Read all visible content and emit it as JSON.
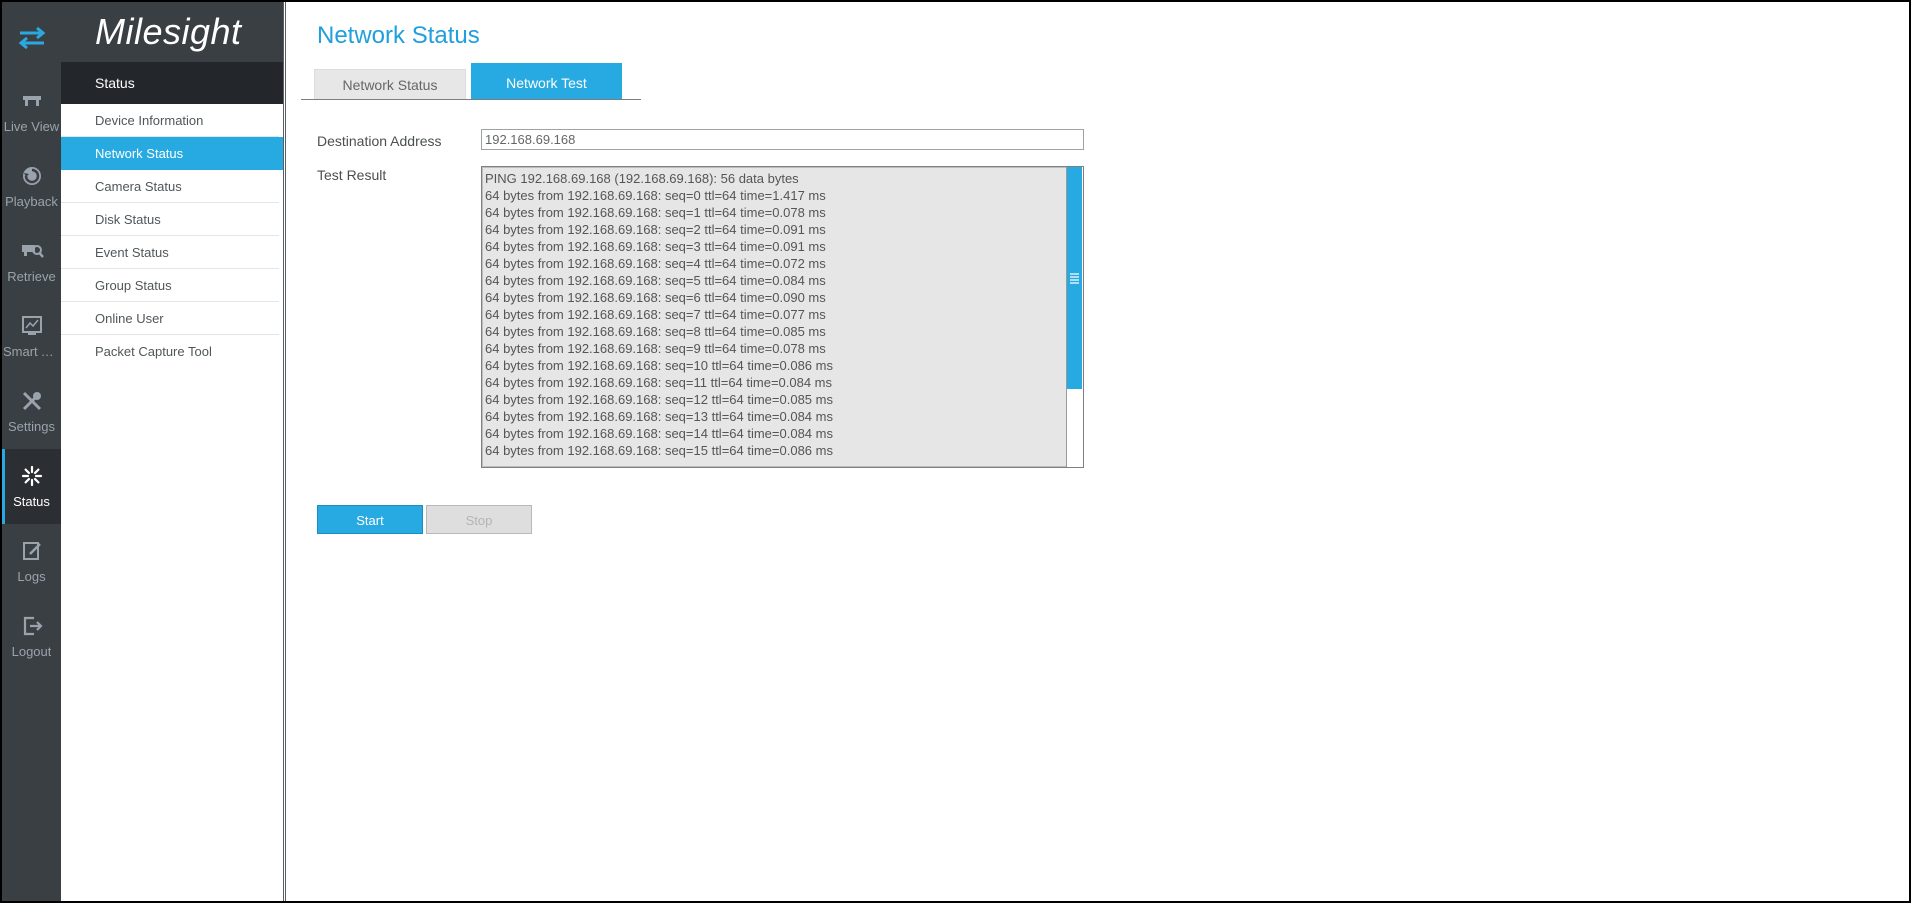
{
  "app": {
    "logo": "Milesight"
  },
  "rail": {
    "items": [
      {
        "label": "Live View",
        "icon": "live-view-icon"
      },
      {
        "label": "Playback",
        "icon": "playback-icon"
      },
      {
        "label": "Retrieve",
        "icon": "retrieve-icon"
      },
      {
        "label": "Smart A...",
        "icon": "smart-analysis-icon"
      },
      {
        "label": "Settings",
        "icon": "settings-icon"
      },
      {
        "label": "Status",
        "icon": "status-icon",
        "active": true
      },
      {
        "label": "Logs",
        "icon": "logs-icon"
      },
      {
        "label": "Logout",
        "icon": "logout-icon"
      }
    ]
  },
  "sidebar": {
    "section_title": "Status",
    "items": [
      {
        "label": "Device Information"
      },
      {
        "label": "Network Status",
        "active": true
      },
      {
        "label": "Camera Status"
      },
      {
        "label": "Disk Status"
      },
      {
        "label": "Event Status"
      },
      {
        "label": "Group Status"
      },
      {
        "label": "Online User"
      },
      {
        "label": "Packet Capture Tool"
      }
    ]
  },
  "main": {
    "title": "Network Status",
    "tabs": [
      {
        "label": "Network Status",
        "active": false
      },
      {
        "label": "Network Test",
        "active": true
      }
    ],
    "destination_label": "Destination Address",
    "destination_value": "192.168.69.168",
    "result_label": "Test Result",
    "result_lines": [
      "PING 192.168.69.168 (192.168.69.168): 56 data bytes",
      "64 bytes from 192.168.69.168: seq=0 ttl=64 time=1.417 ms",
      "64 bytes from 192.168.69.168: seq=1 ttl=64 time=0.078 ms",
      "64 bytes from 192.168.69.168: seq=2 ttl=64 time=0.091 ms",
      "64 bytes from 192.168.69.168: seq=3 ttl=64 time=0.091 ms",
      "64 bytes from 192.168.69.168: seq=4 ttl=64 time=0.072 ms",
      "64 bytes from 192.168.69.168: seq=5 ttl=64 time=0.084 ms",
      "64 bytes from 192.168.69.168: seq=6 ttl=64 time=0.090 ms",
      "64 bytes from 192.168.69.168: seq=7 ttl=64 time=0.077 ms",
      "64 bytes from 192.168.69.168: seq=8 ttl=64 time=0.085 ms",
      "64 bytes from 192.168.69.168: seq=9 ttl=64 time=0.078 ms",
      "64 bytes from 192.168.69.168: seq=10 ttl=64 time=0.086 ms",
      "64 bytes from 192.168.69.168: seq=11 ttl=64 time=0.084 ms",
      "64 bytes from 192.168.69.168: seq=12 ttl=64 time=0.085 ms",
      "64 bytes from 192.168.69.168: seq=13 ttl=64 time=0.084 ms",
      "64 bytes from 192.168.69.168: seq=14 ttl=64 time=0.084 ms",
      "64 bytes from 192.168.69.168: seq=15 ttl=64 time=0.086 ms"
    ],
    "start_label": "Start",
    "stop_label": "Stop"
  },
  "colors": {
    "accent": "#27aae1",
    "rail_bg": "#3a3f44",
    "section_bg": "#23272b",
    "title": "#1f9fdb"
  }
}
